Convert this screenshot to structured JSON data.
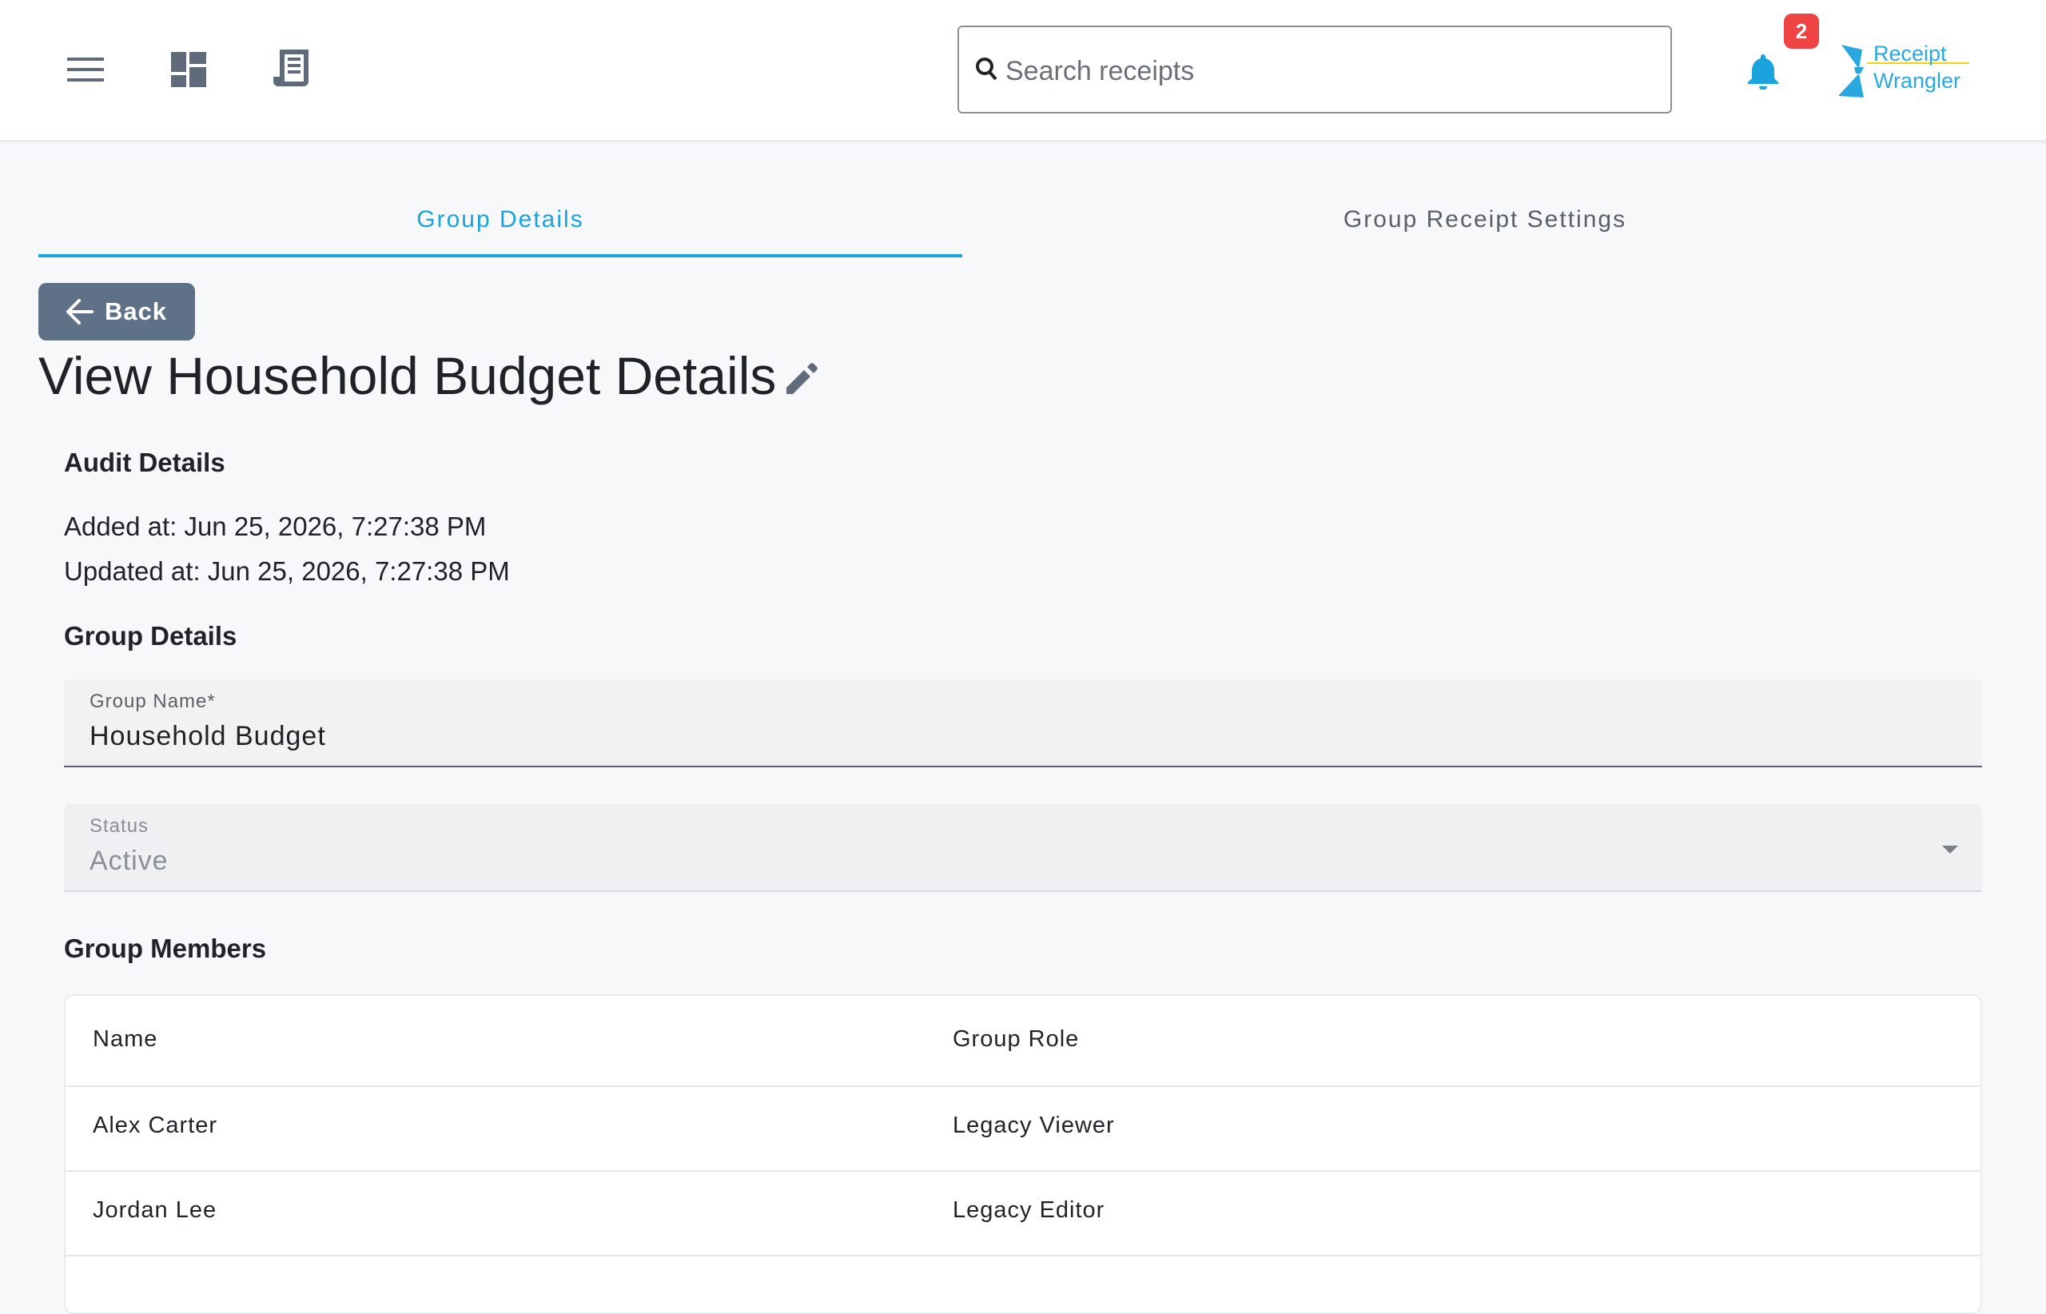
{
  "header": {
    "search_placeholder": "Search receipts",
    "notification_count": "2",
    "logo_line1": "Receipt",
    "logo_line2": "Wrangler",
    "icons": [
      "menu-icon",
      "dashboard-icon",
      "receipt-icon",
      "search-icon",
      "bell-icon"
    ]
  },
  "tabs": [
    {
      "label": "Group Details",
      "active": true
    },
    {
      "label": "Group Receipt Settings",
      "active": false
    }
  ],
  "back_label": "Back",
  "page_title": "View Household Budget Details",
  "audit": {
    "title": "Audit Details",
    "added": "Added at: Jun 25, 2026, 7:27:38 PM",
    "updated": "Updated at: Jun 25, 2026, 7:27:38 PM"
  },
  "group_details": {
    "title": "Group Details",
    "name_label": "Group Name*",
    "name_value": "Household Budget",
    "status_label": "Status",
    "status_value": "Active"
  },
  "members": {
    "title": "Group Members",
    "columns": [
      "Name",
      "Group Role"
    ],
    "rows": [
      {
        "name": "Alex Carter",
        "role": "Legacy Viewer"
      },
      {
        "name": "Jordan Lee",
        "role": "Legacy Editor"
      }
    ]
  },
  "colors": {
    "accent": "#1aa3dc",
    "back_button": "#5f7186",
    "badge": "#ef4444",
    "bell": "#1aa3dc"
  }
}
